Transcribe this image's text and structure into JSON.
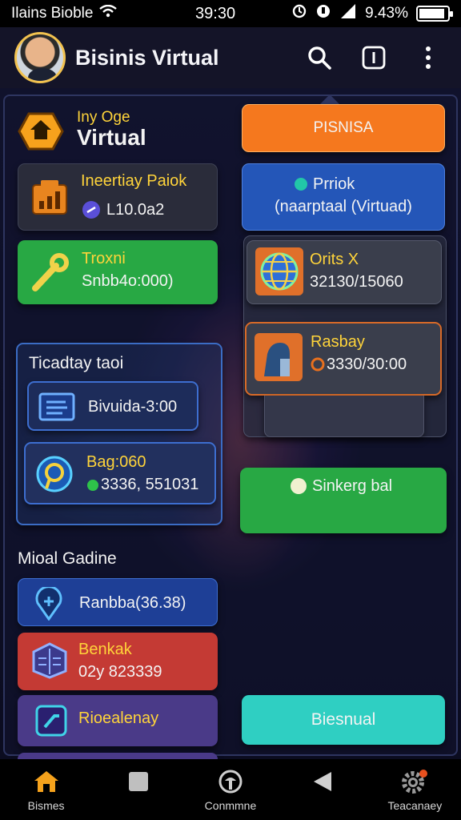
{
  "status_bar": {
    "carrier": "Ilains Bioble",
    "time": "39:30",
    "battery": "9.43%",
    "battery_level": 0.9
  },
  "header": {
    "title": "Bisinis Virtual"
  },
  "brand": {
    "small": "Iny Oge",
    "big": "Virtual"
  },
  "left_cards": [
    {
      "title": "Ineertiay Paiok",
      "value": "L10.0a2"
    },
    {
      "title": "Troxni",
      "value": "Snbb4o:000)"
    }
  ],
  "info_section": {
    "title": "Ticadtay taoi",
    "item1": "Bivuida-3:00",
    "item2_title": "Bag:060",
    "item2_value": "3336, 551031"
  },
  "bottom_section": {
    "title": "Mioal Gadine",
    "item1": "Ranbba(36.38)",
    "item2_title": "Benkak",
    "item2_value": "02y 823339",
    "item3": "Rioealenay"
  },
  "right": {
    "orange_button": "PISNISA",
    "blue_card_line1": "Prriok",
    "blue_card_line2": "(naarptaal (Virtuad)",
    "card1_title": "Orits X",
    "card1_value": "32130/15060",
    "card2_title": "Rasbay",
    "card2_value": "3330/30:00",
    "green_button": "Sinkerg bal",
    "teal_button": "Biesnual"
  },
  "bottom_nav": [
    {
      "label": "Bismes",
      "icon": "home-icon"
    },
    {
      "label": "",
      "icon": "square-icon"
    },
    {
      "label": "Conmmne",
      "icon": "compass-icon"
    },
    {
      "label": "",
      "icon": "back-icon"
    },
    {
      "label": "Teacanaey",
      "icon": "gear-icon"
    }
  ],
  "colors": {
    "orange": "#f5781e",
    "blue": "#2456b8",
    "green": "#28a844",
    "teal": "#2fcfc2",
    "red": "#c43a34",
    "purple": "#4a3a88",
    "accent_yellow": "#ffd43a"
  }
}
